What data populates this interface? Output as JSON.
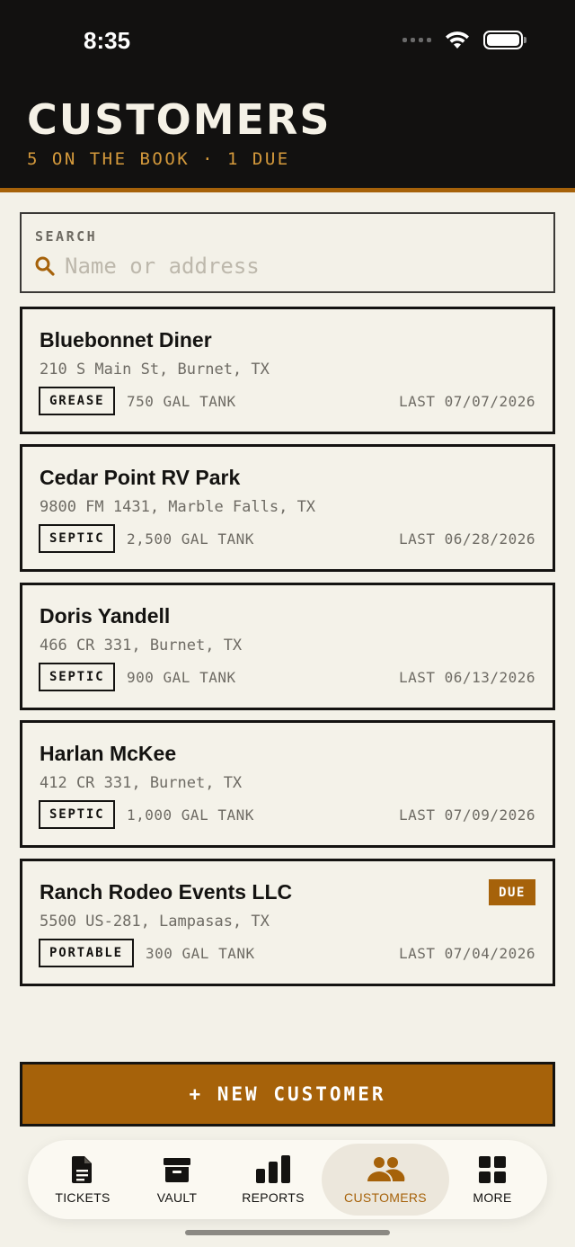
{
  "status_bar": {
    "time": "8:35"
  },
  "header": {
    "title": "CUSTOMERS",
    "subtitle": "5 ON THE BOOK · 1 DUE"
  },
  "search": {
    "label": "SEARCH",
    "placeholder": "Name or address",
    "value": ""
  },
  "customers": [
    {
      "name": "Bluebonnet Diner",
      "address": "210 S Main St, Burnet, TX",
      "type": "GREASE",
      "tank": "750 GAL TANK",
      "last": "LAST 07/07/2026",
      "due": ""
    },
    {
      "name": "Cedar Point RV Park",
      "address": "9800 FM 1431, Marble Falls, TX",
      "type": "SEPTIC",
      "tank": "2,500 GAL TANK",
      "last": "LAST 06/28/2026",
      "due": ""
    },
    {
      "name": "Doris Yandell",
      "address": "466 CR 331, Burnet, TX",
      "type": "SEPTIC",
      "tank": "900 GAL TANK",
      "last": "LAST 06/13/2026",
      "due": ""
    },
    {
      "name": "Harlan McKee",
      "address": "412 CR 331, Burnet, TX",
      "type": "SEPTIC",
      "tank": "1,000 GAL TANK",
      "last": "LAST 07/09/2026",
      "due": ""
    },
    {
      "name": "Ranch Rodeo Events LLC",
      "address": "5500 US-281, Lampasas, TX",
      "type": "PORTABLE",
      "tank": "300 GAL TANK",
      "last": "LAST 07/04/2026",
      "due": "DUE"
    }
  ],
  "new_customer_button": "+ NEW CUSTOMER",
  "tabs": [
    {
      "label": "TICKETS",
      "icon": "document-icon"
    },
    {
      "label": "VAULT",
      "icon": "archive-box-icon"
    },
    {
      "label": "REPORTS",
      "icon": "bar-chart-icon"
    },
    {
      "label": "CUSTOMERS",
      "icon": "people-icon",
      "active": true
    },
    {
      "label": "MORE",
      "icon": "grid-icon"
    }
  ],
  "colors": {
    "accent": "#A6620A",
    "header_bg": "#121110",
    "background": "#F3F1E8",
    "subtitle": "#D59A3C"
  }
}
